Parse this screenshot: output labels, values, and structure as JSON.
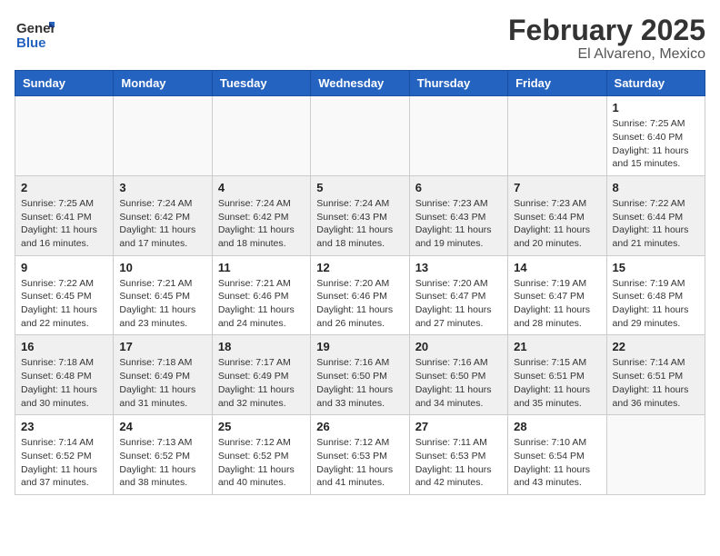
{
  "header": {
    "logo_general": "General",
    "logo_blue": "Blue",
    "month": "February 2025",
    "location": "El Alvareno, Mexico"
  },
  "weekdays": [
    "Sunday",
    "Monday",
    "Tuesday",
    "Wednesday",
    "Thursday",
    "Friday",
    "Saturday"
  ],
  "weeks": [
    [
      {
        "day": "",
        "info": ""
      },
      {
        "day": "",
        "info": ""
      },
      {
        "day": "",
        "info": ""
      },
      {
        "day": "",
        "info": ""
      },
      {
        "day": "",
        "info": ""
      },
      {
        "day": "",
        "info": ""
      },
      {
        "day": "1",
        "info": "Sunrise: 7:25 AM\nSunset: 6:40 PM\nDaylight: 11 hours\nand 15 minutes."
      }
    ],
    [
      {
        "day": "2",
        "info": "Sunrise: 7:25 AM\nSunset: 6:41 PM\nDaylight: 11 hours\nand 16 minutes."
      },
      {
        "day": "3",
        "info": "Sunrise: 7:24 AM\nSunset: 6:42 PM\nDaylight: 11 hours\nand 17 minutes."
      },
      {
        "day": "4",
        "info": "Sunrise: 7:24 AM\nSunset: 6:42 PM\nDaylight: 11 hours\nand 18 minutes."
      },
      {
        "day": "5",
        "info": "Sunrise: 7:24 AM\nSunset: 6:43 PM\nDaylight: 11 hours\nand 18 minutes."
      },
      {
        "day": "6",
        "info": "Sunrise: 7:23 AM\nSunset: 6:43 PM\nDaylight: 11 hours\nand 19 minutes."
      },
      {
        "day": "7",
        "info": "Sunrise: 7:23 AM\nSunset: 6:44 PM\nDaylight: 11 hours\nand 20 minutes."
      },
      {
        "day": "8",
        "info": "Sunrise: 7:22 AM\nSunset: 6:44 PM\nDaylight: 11 hours\nand 21 minutes."
      }
    ],
    [
      {
        "day": "9",
        "info": "Sunrise: 7:22 AM\nSunset: 6:45 PM\nDaylight: 11 hours\nand 22 minutes."
      },
      {
        "day": "10",
        "info": "Sunrise: 7:21 AM\nSunset: 6:45 PM\nDaylight: 11 hours\nand 23 minutes."
      },
      {
        "day": "11",
        "info": "Sunrise: 7:21 AM\nSunset: 6:46 PM\nDaylight: 11 hours\nand 24 minutes."
      },
      {
        "day": "12",
        "info": "Sunrise: 7:20 AM\nSunset: 6:46 PM\nDaylight: 11 hours\nand 26 minutes."
      },
      {
        "day": "13",
        "info": "Sunrise: 7:20 AM\nSunset: 6:47 PM\nDaylight: 11 hours\nand 27 minutes."
      },
      {
        "day": "14",
        "info": "Sunrise: 7:19 AM\nSunset: 6:47 PM\nDaylight: 11 hours\nand 28 minutes."
      },
      {
        "day": "15",
        "info": "Sunrise: 7:19 AM\nSunset: 6:48 PM\nDaylight: 11 hours\nand 29 minutes."
      }
    ],
    [
      {
        "day": "16",
        "info": "Sunrise: 7:18 AM\nSunset: 6:48 PM\nDaylight: 11 hours\nand 30 minutes."
      },
      {
        "day": "17",
        "info": "Sunrise: 7:18 AM\nSunset: 6:49 PM\nDaylight: 11 hours\nand 31 minutes."
      },
      {
        "day": "18",
        "info": "Sunrise: 7:17 AM\nSunset: 6:49 PM\nDaylight: 11 hours\nand 32 minutes."
      },
      {
        "day": "19",
        "info": "Sunrise: 7:16 AM\nSunset: 6:50 PM\nDaylight: 11 hours\nand 33 minutes."
      },
      {
        "day": "20",
        "info": "Sunrise: 7:16 AM\nSunset: 6:50 PM\nDaylight: 11 hours\nand 34 minutes."
      },
      {
        "day": "21",
        "info": "Sunrise: 7:15 AM\nSunset: 6:51 PM\nDaylight: 11 hours\nand 35 minutes."
      },
      {
        "day": "22",
        "info": "Sunrise: 7:14 AM\nSunset: 6:51 PM\nDaylight: 11 hours\nand 36 minutes."
      }
    ],
    [
      {
        "day": "23",
        "info": "Sunrise: 7:14 AM\nSunset: 6:52 PM\nDaylight: 11 hours\nand 37 minutes."
      },
      {
        "day": "24",
        "info": "Sunrise: 7:13 AM\nSunset: 6:52 PM\nDaylight: 11 hours\nand 38 minutes."
      },
      {
        "day": "25",
        "info": "Sunrise: 7:12 AM\nSunset: 6:52 PM\nDaylight: 11 hours\nand 40 minutes."
      },
      {
        "day": "26",
        "info": "Sunrise: 7:12 AM\nSunset: 6:53 PM\nDaylight: 11 hours\nand 41 minutes."
      },
      {
        "day": "27",
        "info": "Sunrise: 7:11 AM\nSunset: 6:53 PM\nDaylight: 11 hours\nand 42 minutes."
      },
      {
        "day": "28",
        "info": "Sunrise: 7:10 AM\nSunset: 6:54 PM\nDaylight: 11 hours\nand 43 minutes."
      },
      {
        "day": "",
        "info": ""
      }
    ]
  ]
}
